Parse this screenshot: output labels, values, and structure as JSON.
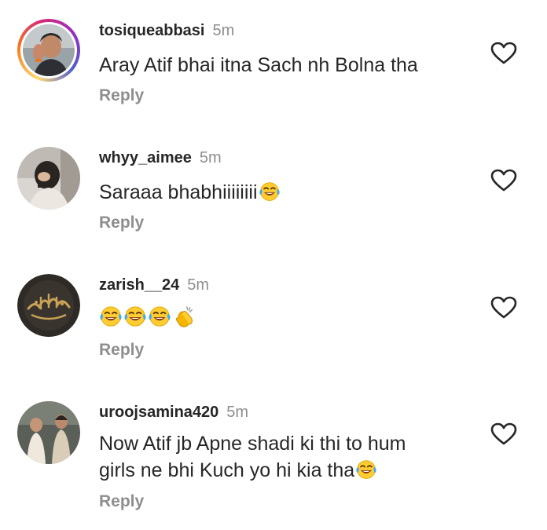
{
  "comments": [
    {
      "username": "tosiqueabbasi",
      "time": "5m",
      "text": "Aray Atif bhai itna Sach nh Bolna tha",
      "emojis": [],
      "reply_label": "Reply"
    },
    {
      "username": "whyy_aimee",
      "time": "5m",
      "text": "Saraaa bhabhiiiiiiii",
      "emojis": [
        "face-with-tears-of-joy"
      ],
      "reply_label": "Reply"
    },
    {
      "username": "zarish__24",
      "time": "5m",
      "text": "",
      "emojis": [
        "face-with-tears-of-joy",
        "face-with-tears-of-joy",
        "face-with-tears-of-joy",
        "clapping-hands"
      ],
      "reply_label": "Reply"
    },
    {
      "username": "uroojsamina420",
      "time": "5m",
      "text_line1": "Now Atif jb Apne shadi ki thi to hum",
      "text_line2": "girls ne bhi Kuch yo hi kia tha",
      "emojis": [
        "face-with-tears-of-joy"
      ],
      "reply_label": "Reply"
    }
  ],
  "colors": {
    "username": "#262626",
    "secondary": "#8e8e8e",
    "story_ring": [
      "#feda75",
      "#fa7e1e",
      "#d62976",
      "#962fbf"
    ]
  },
  "icons": {
    "like": "heart-outline-icon",
    "laugh": "face-with-tears-of-joy-emoji",
    "clap": "clapping-hands-emoji"
  }
}
